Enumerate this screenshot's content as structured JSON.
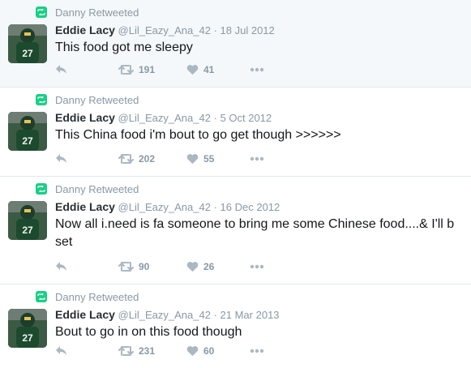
{
  "tweets": [
    {
      "context": "Danny Retweeted",
      "name": "Eddie Lacy",
      "handle": "@Lil_Eazy_Ana_42",
      "separator": "·",
      "date": "18 Jul 2012",
      "text": "This food got me sleepy",
      "retweets": "191",
      "likes": "41"
    },
    {
      "context": "Danny Retweeted",
      "name": "Eddie Lacy",
      "handle": "@Lil_Eazy_Ana_42",
      "separator": "·",
      "date": "5 Oct 2012",
      "text": "This China food i'm bout to go get though >>>>>>",
      "retweets": "202",
      "likes": "55"
    },
    {
      "context": "Danny Retweeted",
      "name": "Eddie Lacy",
      "handle": "@Lil_Eazy_Ana_42",
      "separator": "·",
      "date": "16 Dec 2012",
      "text": "Now all i.need is fa someone to bring me some Chinese food....& I'll b set",
      "retweets": "90",
      "likes": "26"
    },
    {
      "context": "Danny Retweeted",
      "name": "Eddie Lacy",
      "handle": "@Lil_Eazy_Ana_42",
      "separator": "·",
      "date": "21 Mar 2013",
      "text": "Bout to go in on this food though",
      "retweets": "231",
      "likes": "60"
    }
  ],
  "colors": {
    "retweet_badge": "#19cf86",
    "icon_gray": "#aab8c2",
    "meta_gray": "#8899a6",
    "divider": "#e1e8ed"
  },
  "icons": {
    "context": "retweet-badge-icon",
    "avatar": "avatar-photo",
    "reply": "reply-icon",
    "retweet": "retweet-icon",
    "like": "heart-icon",
    "more": "more-dots-icon"
  }
}
